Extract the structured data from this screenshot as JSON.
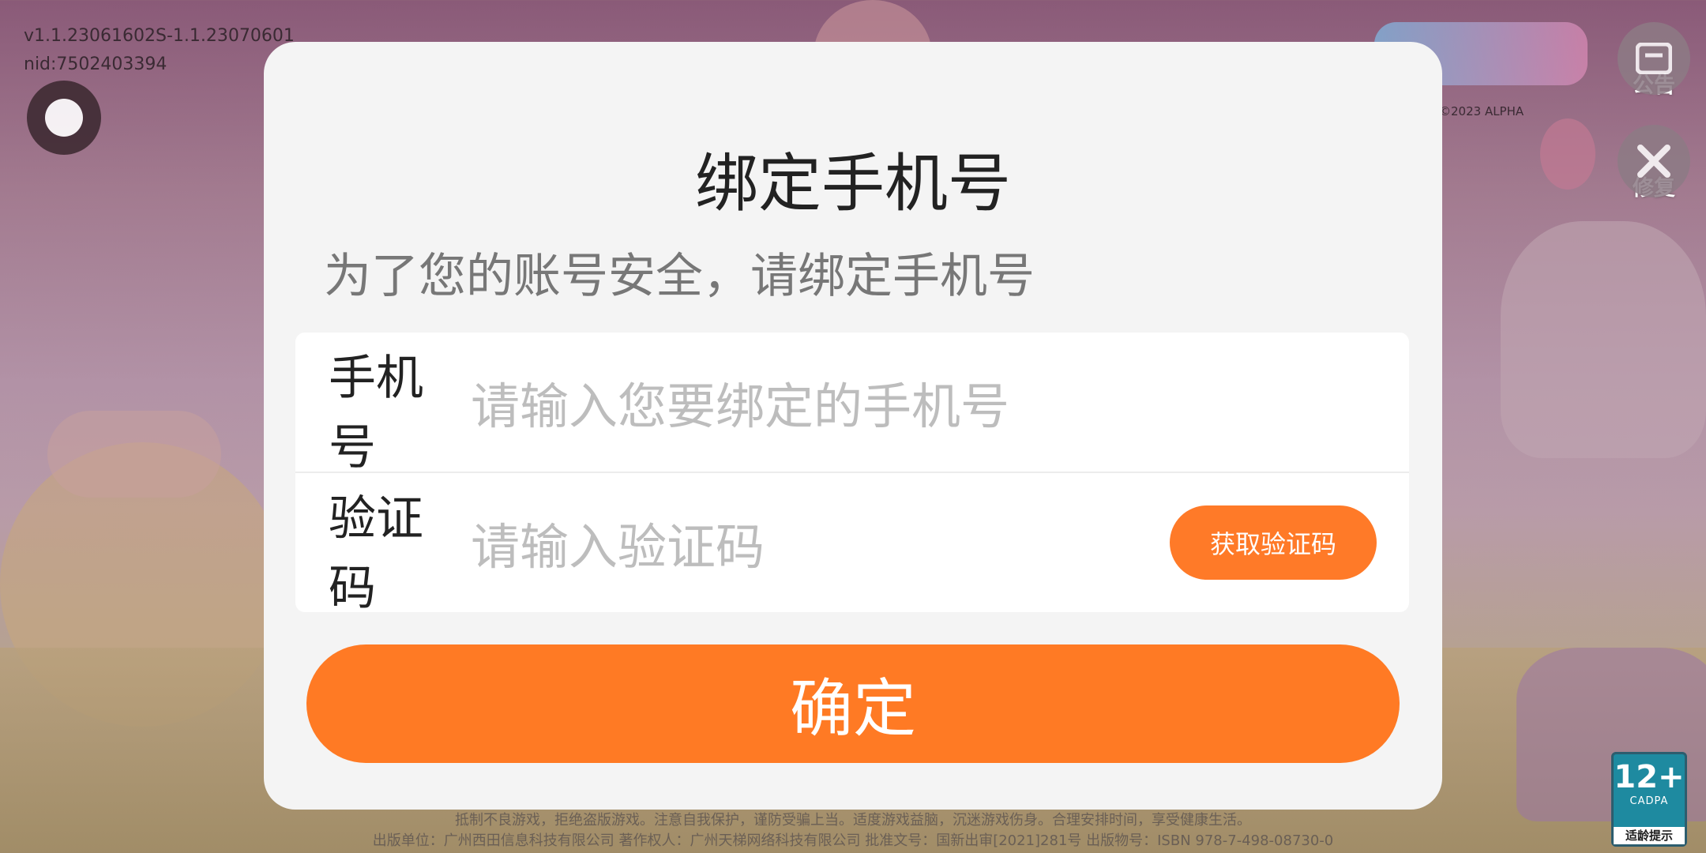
{
  "version": {
    "line1": "v1.1.23061602S-1.1.23070601",
    "line2": "nid:7502403394"
  },
  "logo": {
    "copyright": "©2023 ALPHA"
  },
  "side": {
    "notice_label": "公告",
    "repair_label": "修复"
  },
  "dialog": {
    "title": "绑定手机号",
    "subtitle": "为了您的账号安全，请绑定手机号",
    "phone_label": "手机号",
    "phone_placeholder": "请输入您要绑定的手机号",
    "phone_value": "",
    "code_label": "验证码",
    "code_placeholder": "请输入验证码",
    "code_value": "",
    "get_code_label": "获取验证码",
    "confirm_label": "确定"
  },
  "footer": {
    "line1": "抵制不良游戏，拒绝盗版游戏。注意自我保护，谨防受骗上当。适度游戏益脑，沉迷游戏伤身。合理安排时间，享受健康生活。",
    "line2": "出版单位：广州西田信息科技有限公司 著作权人：广州天梯网络科技有限公司 批准文号：国新出审[2021]281号 出版物号：ISBN 978-7-498-08730-0"
  },
  "age_badge": {
    "rating": "12+",
    "org": "CADPA",
    "tip": "适龄提示"
  },
  "colors": {
    "accent": "#ff7a24",
    "dialog_bg": "#f4f4f4"
  }
}
